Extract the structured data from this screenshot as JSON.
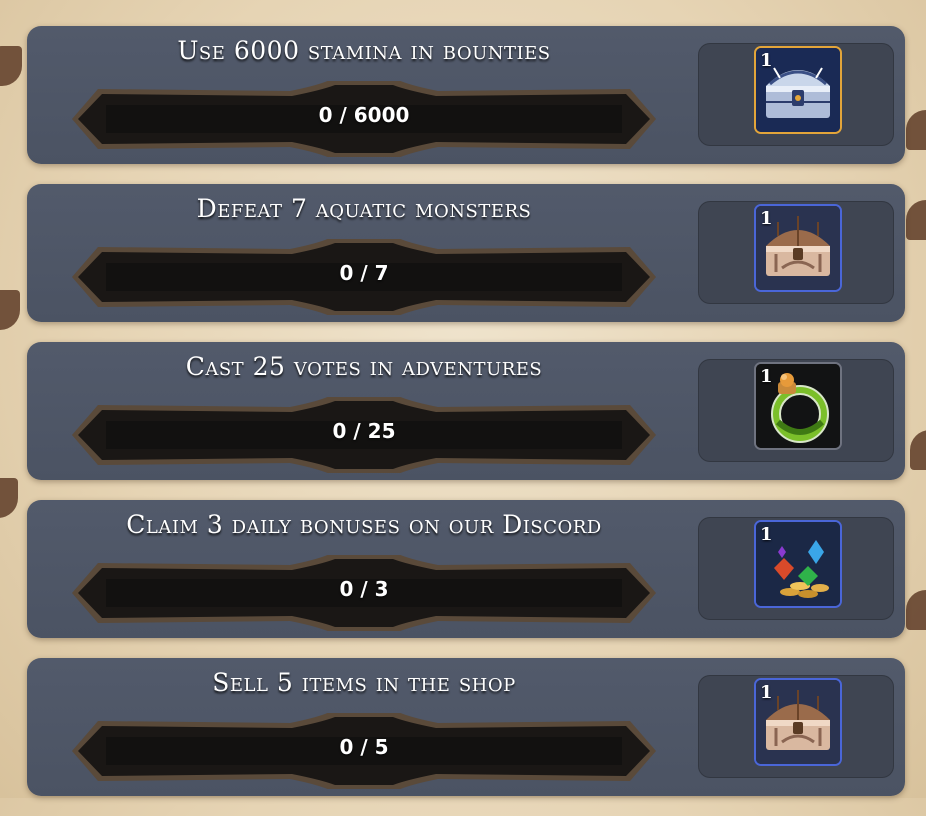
{
  "quests": [
    {
      "title": "Use 6000 stamina in bounties",
      "progress_text": "0 / 6000",
      "progress_fraction": 0,
      "reward": {
        "count": "1",
        "icon": "silver-chest-icon",
        "rarity_color": "#e3a53a"
      }
    },
    {
      "title": "Defeat 7 aquatic monsters",
      "progress_text": "0 / 7",
      "progress_fraction": 0,
      "reward": {
        "count": "1",
        "icon": "wooden-chest-icon",
        "rarity_color": "#4a66d8"
      }
    },
    {
      "title": "Cast 25 votes in adventures",
      "progress_text": "0 / 25",
      "progress_fraction": 0,
      "reward": {
        "count": "1",
        "icon": "potion-ring-icon",
        "rarity_color": "#6f7380"
      }
    },
    {
      "title": "Claim 3 daily bonuses on our Discord",
      "progress_text": "0 / 3",
      "progress_fraction": 0,
      "reward": {
        "count": "1",
        "icon": "gems-and-coins-icon",
        "rarity_color": "#4a66d8"
      }
    },
    {
      "title": "Sell 5 items in the shop",
      "progress_text": "0 / 5",
      "progress_fraction": 0,
      "reward": {
        "count": "1",
        "icon": "wooden-chest-icon",
        "rarity_color": "#4a66d8"
      }
    }
  ]
}
